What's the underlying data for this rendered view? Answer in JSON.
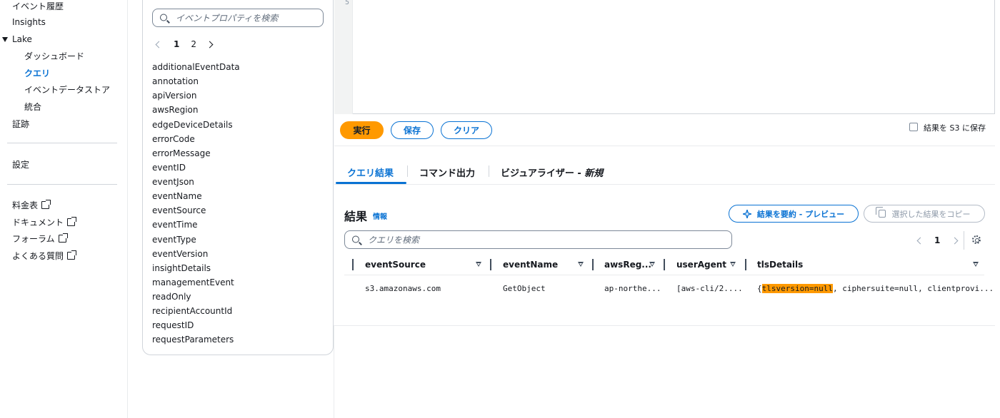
{
  "nav": {
    "event_history": "イベント履歴",
    "insights": "Insights",
    "lake": "Lake",
    "dashboard": "ダッシュボード",
    "query": "クエリ",
    "event_data_store": "イベントデータストア",
    "integration": "統合",
    "trails": "証跡",
    "settings": "設定",
    "pricing": "料金表",
    "documentation": "ドキュメント",
    "forum": "フォーラム",
    "faq": "よくある質問"
  },
  "properties": {
    "search_placeholder": "イベントプロパティを検索",
    "pagination": {
      "page1": "1",
      "page2": "2"
    },
    "items": [
      "additionalEventData",
      "annotation",
      "apiVersion",
      "awsRegion",
      "edgeDeviceDetails",
      "errorCode",
      "errorMessage",
      "eventID",
      "eventJson",
      "eventName",
      "eventSource",
      "eventTime",
      "eventType",
      "eventVersion",
      "insightDetails",
      "managementEvent",
      "readOnly",
      "recipientAccountId",
      "requestID",
      "requestParameters"
    ]
  },
  "editor": {
    "line_number": "5"
  },
  "actions": {
    "run": "実行",
    "save": "保存",
    "clear": "クリア",
    "save_to_s3": "結果を S3 に保存"
  },
  "tabs": {
    "query_results": "クエリ結果",
    "command_output": "コマンド出力",
    "visualizer": "ビジュアライザー - ",
    "visualizer_new": "新規"
  },
  "results": {
    "title": "結果",
    "info": "情報",
    "summarize_button": "結果を要約 - プレビュー",
    "copy_button": "選択した結果をコピー",
    "search_placeholder": "クエリを検索",
    "page": "1",
    "columns": [
      "eventSource",
      "eventName",
      "awsReg...",
      "userAgent",
      "tlsDetails"
    ],
    "row": {
      "eventSource": "s3.amazonaws.com",
      "eventName": "GetObject",
      "awsRegion": "ap-northe...",
      "userAgent": "[aws-cli/2....",
      "tls_prefix": "{",
      "tls_highlight": "tlsversion=null",
      "tls_rest": ", ciphersuite=null, clientprovi..."
    }
  },
  "colors": {
    "accent": "#0972d3",
    "primary_button": "#ff9900",
    "highlight": "#ff9900"
  }
}
